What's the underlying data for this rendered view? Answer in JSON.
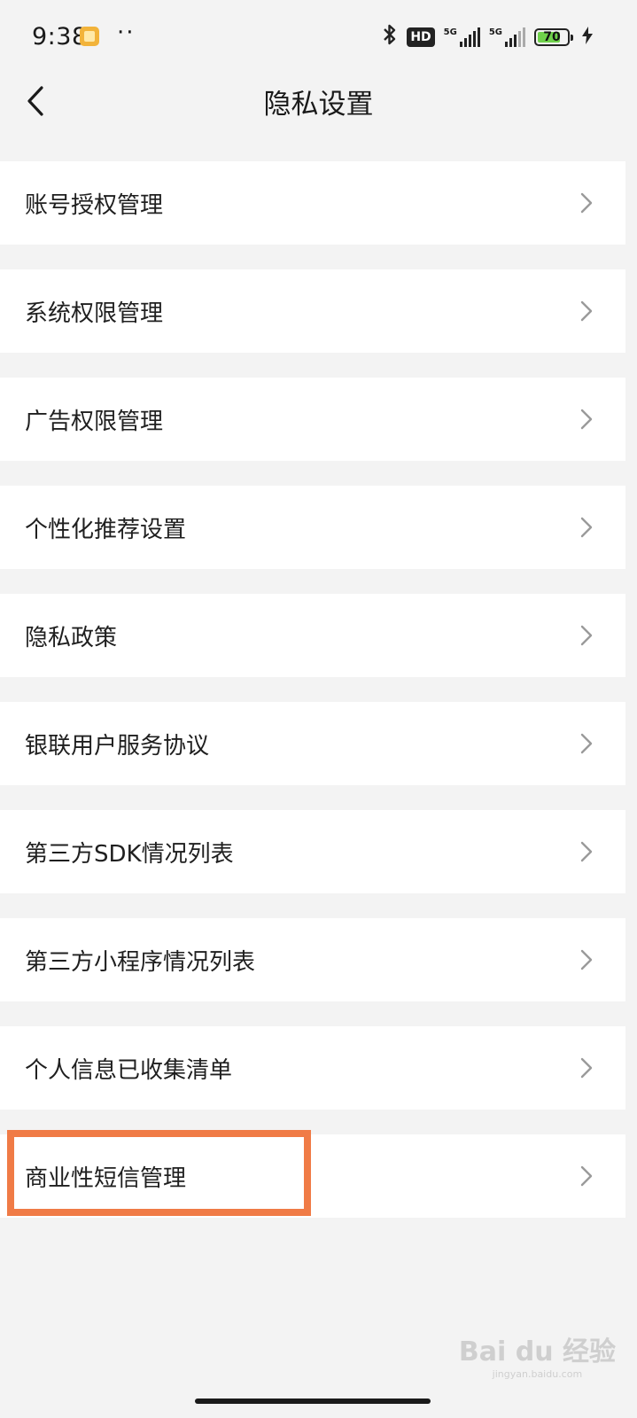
{
  "status_bar": {
    "time": "9:38",
    "dots": "··",
    "hd_label": "HD",
    "network_1": "5G",
    "network_2": "5G",
    "battery_level": "70",
    "notification_icon": "app-notification-icon",
    "bluetooth_icon": "bluetooth-icon",
    "charging_icon": "charging-bolt-icon"
  },
  "header": {
    "title": "隐私设置",
    "back_icon": "chevron-left-icon"
  },
  "menu": {
    "items": [
      {
        "label": "账号授权管理"
      },
      {
        "label": "系统权限管理"
      },
      {
        "label": "广告权限管理"
      },
      {
        "label": "个性化推荐设置"
      },
      {
        "label": "隐私政策"
      },
      {
        "label": "银联用户服务协议"
      },
      {
        "label": "第三方SDK情况列表"
      },
      {
        "label": "第三方小程序情况列表"
      },
      {
        "label": "个人信息已收集清单"
      },
      {
        "label": "商业性短信管理"
      }
    ],
    "chevron_icon": "chevron-right-icon"
  },
  "highlight": {
    "color": "#f07b46",
    "target": "商业性短信管理"
  },
  "watermark": {
    "main": "Bai du 经验",
    "sub": "jingyan.baidu.com"
  }
}
